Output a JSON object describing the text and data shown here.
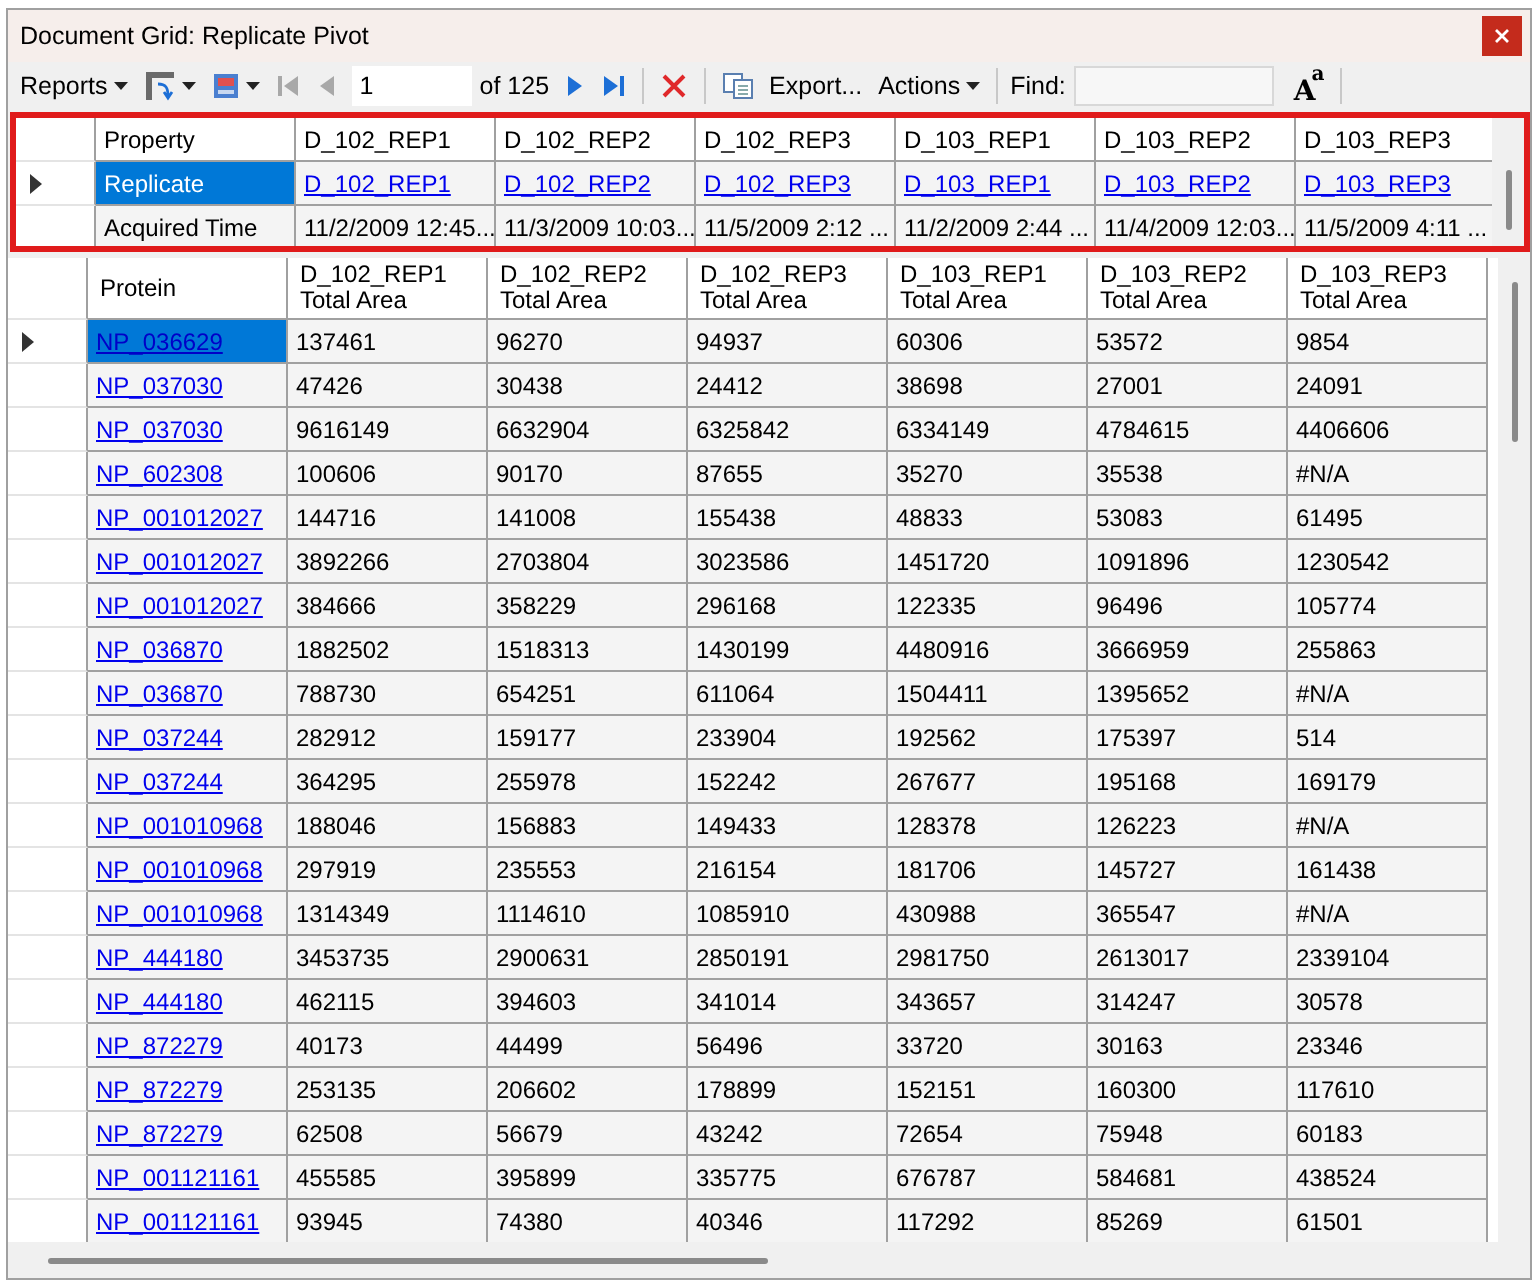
{
  "window": {
    "title": "Document Grid: Replicate Pivot"
  },
  "toolbar": {
    "reports": "Reports",
    "page": "1",
    "page_count": "of 125",
    "export": "Export...",
    "actions": "Actions",
    "find_label": "Find:",
    "font_big": "A",
    "font_small": "a",
    "nav": [
      {
        "kind": "first",
        "disabled": true
      },
      {
        "kind": "prev",
        "disabled": true
      }
    ],
    "nav_after": [
      {
        "kind": "next",
        "disabled": false
      },
      {
        "kind": "last",
        "disabled": false
      }
    ]
  },
  "pivot": {
    "label_header": "Property",
    "columns": [
      "D_102_REP1",
      "D_102_REP2",
      "D_102_REP3",
      "D_103_REP1",
      "D_103_REP2",
      "D_103_REP3"
    ],
    "rows": [
      {
        "label": "Replicate",
        "selected": true,
        "kind": "link",
        "cells": [
          "D_102_REP1",
          "D_102_REP2",
          "D_102_REP3",
          "D_103_REP1",
          "D_103_REP2",
          "D_103_REP3"
        ]
      },
      {
        "label": "Acquired Time",
        "selected": false,
        "kind": "text",
        "cells": [
          "11/2/2009 12:45...",
          "11/3/2009 10:03...",
          "11/5/2009 2:12 ...",
          "11/2/2009 2:44 ...",
          "11/4/2009 12:03...",
          "11/5/2009 4:11 ..."
        ]
      }
    ]
  },
  "grid": {
    "key_header": "Protein",
    "columns": [
      {
        "title": "D_102_REP1",
        "subtitle": "Total Area"
      },
      {
        "title": "D_102_REP2",
        "subtitle": "Total Area"
      },
      {
        "title": "D_102_REP3",
        "subtitle": "Total Area"
      },
      {
        "title": "D_103_REP1",
        "subtitle": "Total Area"
      },
      {
        "title": "D_103_REP2",
        "subtitle": "Total Area"
      },
      {
        "title": "D_103_REP3",
        "subtitle": "Total Area"
      }
    ],
    "rows": [
      {
        "protein": "NP_036629",
        "selected": true,
        "values": [
          "137461",
          "96270",
          "94937",
          "60306",
          "53572",
          "9854"
        ]
      },
      {
        "protein": "NP_037030",
        "selected": false,
        "values": [
          "47426",
          "30438",
          "24412",
          "38698",
          "27001",
          "24091"
        ]
      },
      {
        "protein": "NP_037030",
        "selected": false,
        "values": [
          "9616149",
          "6632904",
          "6325842",
          "6334149",
          "4784615",
          "4406606"
        ]
      },
      {
        "protein": "NP_602308",
        "selected": false,
        "values": [
          "100606",
          "90170",
          "87655",
          "35270",
          "35538",
          "#N/A"
        ]
      },
      {
        "protein": "NP_001012027",
        "selected": false,
        "values": [
          "144716",
          "141008",
          "155438",
          "48833",
          "53083",
          "61495"
        ]
      },
      {
        "protein": "NP_001012027",
        "selected": false,
        "values": [
          "3892266",
          "2703804",
          "3023586",
          "1451720",
          "1091896",
          "1230542"
        ]
      },
      {
        "protein": "NP_001012027",
        "selected": false,
        "values": [
          "384666",
          "358229",
          "296168",
          "122335",
          "96496",
          "105774"
        ]
      },
      {
        "protein": "NP_036870",
        "selected": false,
        "values": [
          "1882502",
          "1518313",
          "1430199",
          "4480916",
          "3666959",
          "255863"
        ]
      },
      {
        "protein": "NP_036870",
        "selected": false,
        "values": [
          "788730",
          "654251",
          "611064",
          "1504411",
          "1395652",
          "#N/A"
        ]
      },
      {
        "protein": "NP_037244",
        "selected": false,
        "values": [
          "282912",
          "159177",
          "233904",
          "192562",
          "175397",
          "514"
        ]
      },
      {
        "protein": "NP_037244",
        "selected": false,
        "values": [
          "364295",
          "255978",
          "152242",
          "267677",
          "195168",
          "169179"
        ]
      },
      {
        "protein": "NP_001010968",
        "selected": false,
        "values": [
          "188046",
          "156883",
          "149433",
          "128378",
          "126223",
          "#N/A"
        ]
      },
      {
        "protein": "NP_001010968",
        "selected": false,
        "values": [
          "297919",
          "235553",
          "216154",
          "181706",
          "145727",
          "161438"
        ]
      },
      {
        "protein": "NP_001010968",
        "selected": false,
        "values": [
          "1314349",
          "1114610",
          "1085910",
          "430988",
          "365547",
          "#N/A"
        ]
      },
      {
        "protein": "NP_444180",
        "selected": false,
        "values": [
          "3453735",
          "2900631",
          "2850191",
          "2981750",
          "2613017",
          "2339104"
        ]
      },
      {
        "protein": "NP_444180",
        "selected": false,
        "values": [
          "462115",
          "394603",
          "341014",
          "343657",
          "314247",
          "30578"
        ]
      },
      {
        "protein": "NP_872279",
        "selected": false,
        "values": [
          "40173",
          "44499",
          "56496",
          "33720",
          "30163",
          "23346"
        ]
      },
      {
        "protein": "NP_872279",
        "selected": false,
        "values": [
          "253135",
          "206602",
          "178899",
          "152151",
          "160300",
          "117610"
        ]
      },
      {
        "protein": "NP_872279",
        "selected": false,
        "values": [
          "62508",
          "56679",
          "43242",
          "72654",
          "75948",
          "60183"
        ]
      },
      {
        "protein": "NP_001121161",
        "selected": false,
        "values": [
          "455585",
          "395899",
          "335775",
          "676787",
          "584681",
          "438524"
        ]
      },
      {
        "protein": "NP_001121161",
        "selected": false,
        "values": [
          "93945",
          "74380",
          "40346",
          "117292",
          "85269",
          "61501"
        ]
      }
    ]
  }
}
